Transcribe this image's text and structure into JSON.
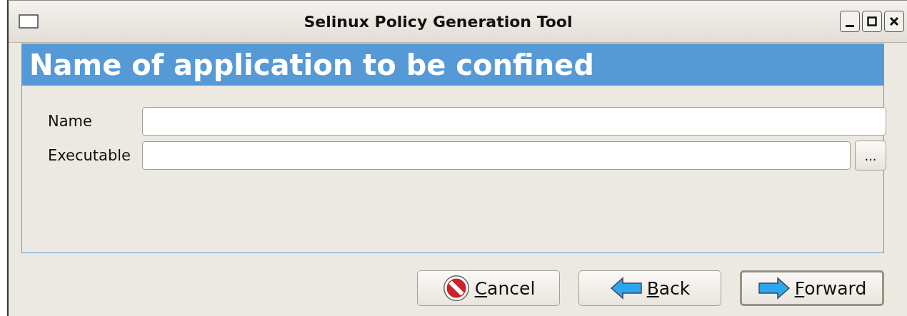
{
  "window": {
    "title": "Selinux Policy Generation Tool"
  },
  "header": {
    "title": "Name of application to be confined"
  },
  "fields": [
    {
      "label": "Name",
      "browse": false
    },
    {
      "label": "Executable",
      "browse": true,
      "browse_label": "..."
    }
  ],
  "buttons": [
    {
      "label": "Cancel",
      "kind": "cancel",
      "default": false
    },
    {
      "label": "Back",
      "kind": "back",
      "default": false
    },
    {
      "label": "Forward",
      "kind": "forward",
      "default": true
    }
  ]
}
